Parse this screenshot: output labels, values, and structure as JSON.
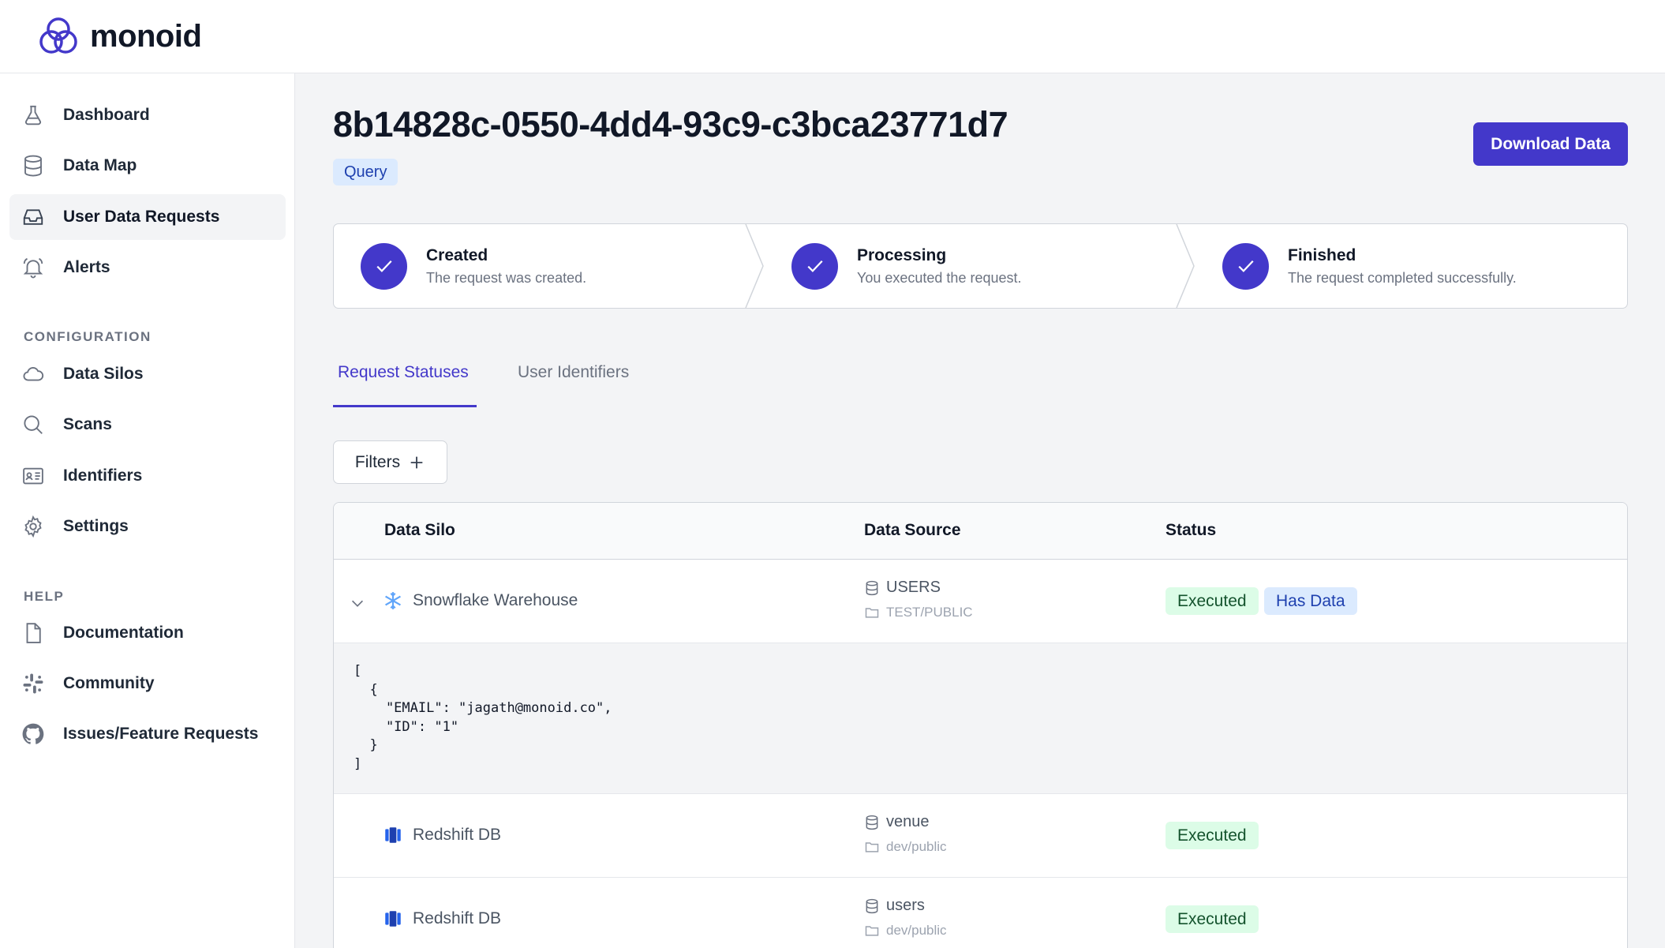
{
  "brand": {
    "name": "monoid",
    "accent": "#4338ca"
  },
  "sidebar": {
    "items": [
      {
        "label": "Dashboard",
        "icon": "flask-icon"
      },
      {
        "label": "Data Map",
        "icon": "database-icon"
      },
      {
        "label": "User Data Requests",
        "icon": "inbox-icon",
        "active": true
      },
      {
        "label": "Alerts",
        "icon": "bell-icon"
      }
    ],
    "configuration_label": "CONFIGURATION",
    "configuration_items": [
      {
        "label": "Data Silos",
        "icon": "cloud-icon"
      },
      {
        "label": "Scans",
        "icon": "search-icon"
      },
      {
        "label": "Identifiers",
        "icon": "id-card-icon"
      },
      {
        "label": "Settings",
        "icon": "gear-icon"
      }
    ],
    "help_label": "HELP",
    "help_items": [
      {
        "label": "Documentation",
        "icon": "document-icon"
      },
      {
        "label": "Community",
        "icon": "slack-icon"
      },
      {
        "label": "Issues/Feature Requests",
        "icon": "github-icon"
      }
    ]
  },
  "page": {
    "title": "8b14828c-0550-4dd4-93c9-c3bca23771d7",
    "type_badge": "Query",
    "download_label": "Download Data"
  },
  "steps": [
    {
      "title": "Created",
      "desc": "The request was created.",
      "done": true
    },
    {
      "title": "Processing",
      "desc": "You executed the request.",
      "done": true
    },
    {
      "title": "Finished",
      "desc": "The request completed successfully.",
      "done": true
    }
  ],
  "tabs": [
    {
      "label": "Request Statuses",
      "active": true
    },
    {
      "label": "User Identifiers",
      "active": false
    }
  ],
  "filters_label": "Filters",
  "table": {
    "headers": {
      "silo": "Data Silo",
      "source": "Data Source",
      "status": "Status"
    },
    "rows": [
      {
        "silo": "Snowflake Warehouse",
        "silo_icon": "snowflake-icon",
        "source": "USERS",
        "path": "TEST/PUBLIC",
        "status": "Executed",
        "extra_badge": "Has Data",
        "expanded": true,
        "json": "[\n  {\n    \"EMAIL\": \"jagath@monoid.co\",\n    \"ID\": \"1\"\n  }\n]"
      },
      {
        "silo": "Redshift DB",
        "silo_icon": "redshift-icon",
        "source": "venue",
        "path": "dev/public",
        "status": "Executed"
      },
      {
        "silo": "Redshift DB",
        "silo_icon": "redshift-icon",
        "source": "users",
        "path": "dev/public",
        "status": "Executed"
      }
    ]
  }
}
